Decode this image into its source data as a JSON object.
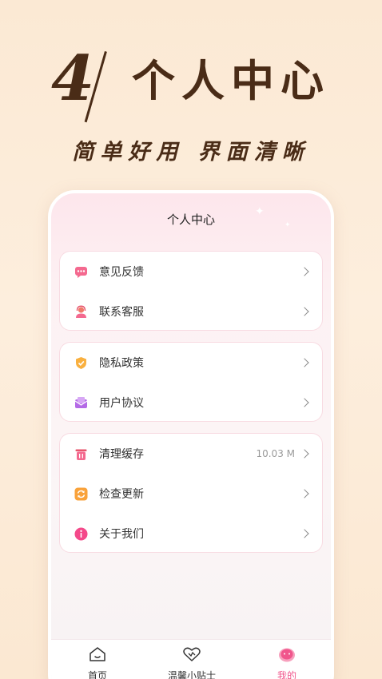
{
  "hero": {
    "number": "4",
    "title": "个人中心",
    "subtitle": "简单好用 界面清晰"
  },
  "page": {
    "title": "个人中心"
  },
  "groups": [
    {
      "items": [
        {
          "label": "意见反馈",
          "icon": "feedback-icon"
        },
        {
          "label": "联系客服",
          "icon": "customer-service-icon"
        }
      ]
    },
    {
      "items": [
        {
          "label": "隐私政策",
          "icon": "shield-check-icon"
        },
        {
          "label": "用户协议",
          "icon": "envelope-icon"
        }
      ]
    },
    {
      "items": [
        {
          "label": "清理缓存",
          "icon": "trash-icon",
          "value": "10.03 M"
        },
        {
          "label": "检查更新",
          "icon": "refresh-icon"
        },
        {
          "label": "关于我们",
          "icon": "info-icon"
        }
      ]
    }
  ],
  "tabs": [
    {
      "label": "首页",
      "icon": "home-icon",
      "active": false
    },
    {
      "label": "温馨小贴士",
      "icon": "heart-icon",
      "active": false
    },
    {
      "label": "我的",
      "icon": "profile-icon",
      "active": true
    }
  ],
  "colors": {
    "accent": "#f0568c",
    "heading": "#4a2c17",
    "background": "#fbe9d4"
  }
}
